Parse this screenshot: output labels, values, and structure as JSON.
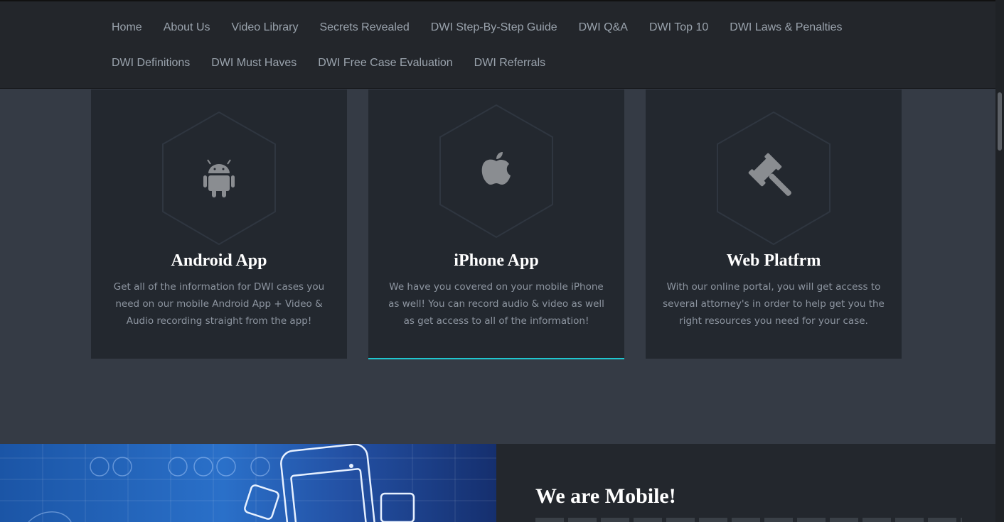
{
  "nav": {
    "row1": [
      "Home",
      "About Us",
      "Video Library",
      "Secrets Revealed",
      "DWI Step-By-Step Guide",
      "DWI Q&A",
      "DWI Top 10",
      "DWI Laws & Penalties"
    ],
    "row2": [
      "DWI Definitions",
      "DWI Must Haves",
      "DWI Free Case Evaluation",
      "DWI Referrals"
    ]
  },
  "cards": [
    {
      "icon": "android-icon",
      "title": "Android App",
      "text": "Get all of the information for DWI cases you need on our mobile Android App + Video & Audio recording straight from the app!"
    },
    {
      "icon": "apple-icon",
      "title": "iPhone App",
      "text": "We have you covered on your mobile iPhone as well! You can record audio & video as well as get access to all of the information!"
    },
    {
      "icon": "gavel-icon",
      "title": "Web Platfrm",
      "text": "With our online portal, you will get access to several attorney's in order to help get you the right resources you need for your case."
    }
  ],
  "mobile_section": {
    "heading": "We are Mobile!"
  },
  "colors": {
    "accent": "#1fc6cf",
    "nav_bg": "#23262b",
    "page_bg": "#353b45",
    "card_bg": "#23282f"
  }
}
